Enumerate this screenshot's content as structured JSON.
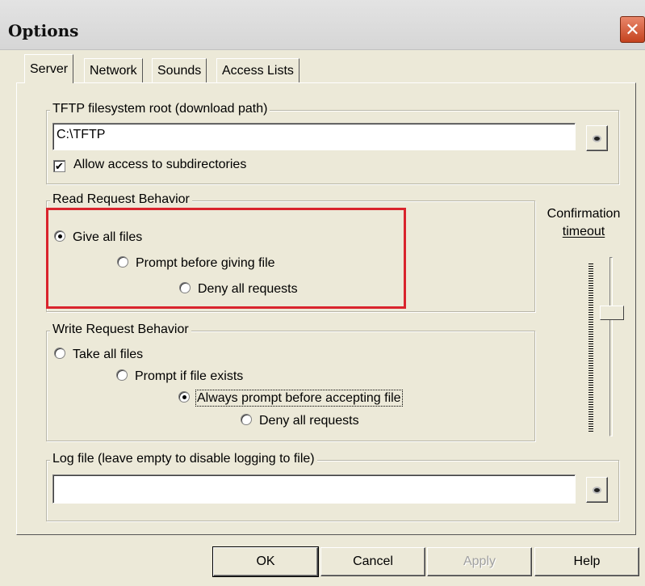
{
  "window": {
    "title": "Options",
    "close_glyph": "✕"
  },
  "tabs": [
    {
      "label": "Server",
      "active": true
    },
    {
      "label": "Network",
      "active": false
    },
    {
      "label": "Sounds",
      "active": false
    },
    {
      "label": "Access Lists",
      "active": false
    }
  ],
  "root_group": {
    "legend": "TFTP filesystem root (download path)",
    "path_value": "C:\\TFTP",
    "allow_subdirs_label": "Allow access to subdirectories",
    "allow_subdirs_checked": true,
    "check_glyph": "✔"
  },
  "read_group": {
    "legend": "Read Request Behavior",
    "options": [
      {
        "label": "Give all files",
        "selected": true
      },
      {
        "label": "Prompt before giving file",
        "selected": false
      },
      {
        "label": "Deny all requests",
        "selected": false
      }
    ]
  },
  "write_group": {
    "legend": "Write Request Behavior",
    "options": [
      {
        "label": "Take all files",
        "selected": false
      },
      {
        "label": "Prompt if file exists",
        "selected": false
      },
      {
        "label": "Always prompt before accepting file",
        "selected": true
      },
      {
        "label": "Deny all requests",
        "selected": false
      }
    ]
  },
  "confirmation": {
    "label_line1": "Confirmation",
    "label_line2": "timeout"
  },
  "log_group": {
    "legend": "Log file (leave empty to disable logging to file)",
    "path_value": ""
  },
  "buttons": {
    "ok": "OK",
    "cancel": "Cancel",
    "apply": "Apply",
    "help": "Help"
  },
  "colors": {
    "highlight_box": "#d9242d",
    "dialog_bg": "#ece9d8",
    "close_button": "#c4431f"
  }
}
